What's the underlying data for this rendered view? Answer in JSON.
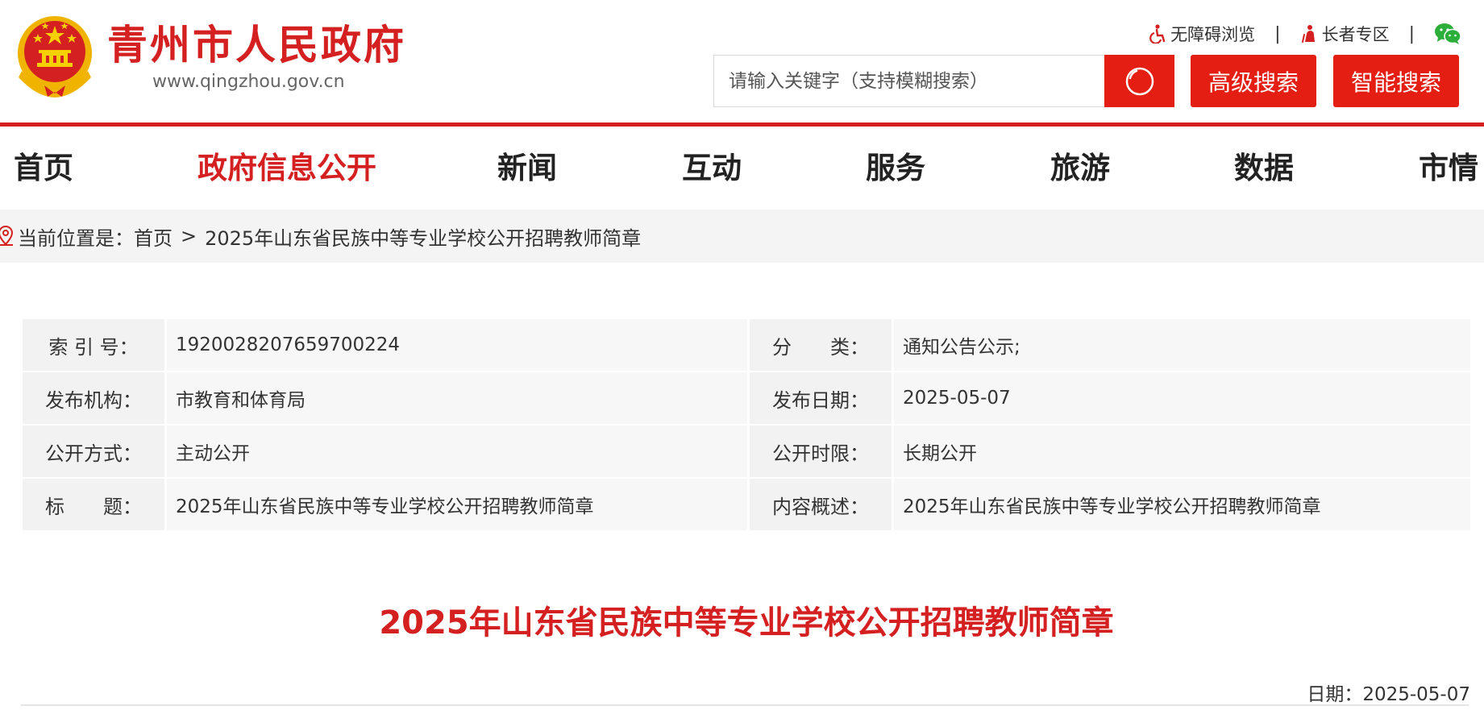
{
  "header": {
    "site_title": "青州市人民政府",
    "site_url": "www.qingzhou.gov.cn",
    "accessibility_label": "无障碍浏览",
    "elderly_label": "长者专区",
    "separator": "|",
    "search_placeholder": "请输入关键字（支持模糊搜索）",
    "advanced_search_label": "高级搜索",
    "smart_search_label": "智能搜索"
  },
  "nav": {
    "items": [
      {
        "label": "首页"
      },
      {
        "label": "政府信息公开"
      },
      {
        "label": "新闻"
      },
      {
        "label": "互动"
      },
      {
        "label": "服务"
      },
      {
        "label": "旅游"
      },
      {
        "label": "数据"
      },
      {
        "label": "市情"
      }
    ],
    "active_index": 1
  },
  "breadcrumb": {
    "prefix": "当前位置是：",
    "home": "首页",
    "separator": ">",
    "current": "2025年山东省民族中等专业学校公开招聘教师简章"
  },
  "meta": {
    "rows": [
      {
        "left_label": "索 引 号：",
        "left_value": "1920028207659700224",
        "right_label": "分　　类：",
        "right_value": "通知公告公示;"
      },
      {
        "left_label": "发布机构：",
        "left_value": "市教育和体育局",
        "right_label": "发布日期：",
        "right_value": "2025-05-07"
      },
      {
        "left_label": "公开方式：",
        "left_value": "主动公开",
        "right_label": "公开时限：",
        "right_value": "长期公开"
      },
      {
        "left_label": "标　　题：",
        "left_value": "2025年山东省民族中等专业学校公开招聘教师简章",
        "right_label": "内容概述：",
        "right_value": "2025年山东省民族中等专业学校公开招聘教师简章"
      }
    ]
  },
  "article": {
    "title": "2025年山东省民族中等专业学校公开招聘教师简章",
    "date_label": "日期：",
    "date": "2025-05-07"
  },
  "colors": {
    "brand_red": "#d42020",
    "button_red": "#e41e13"
  }
}
